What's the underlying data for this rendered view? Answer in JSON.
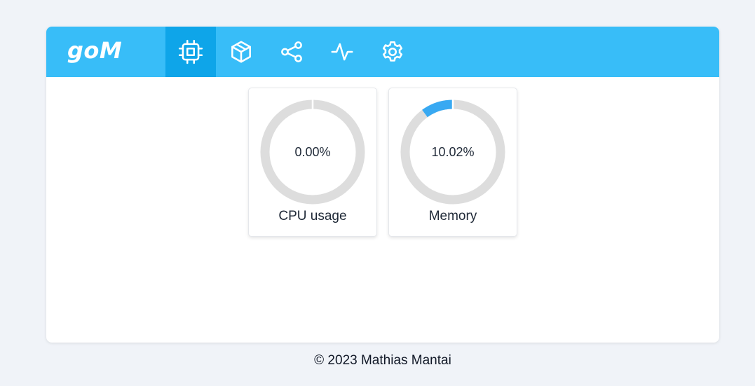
{
  "app": {
    "brand": "goM"
  },
  "nav": {
    "tabs": [
      {
        "name": "tab-system",
        "icon": "cpu-icon",
        "active": true
      },
      {
        "name": "tab-packages",
        "icon": "package-icon",
        "active": false
      },
      {
        "name": "tab-network",
        "icon": "share-icon",
        "active": false
      },
      {
        "name": "tab-activity",
        "icon": "activity-icon",
        "active": false
      },
      {
        "name": "tab-settings",
        "icon": "gear-icon",
        "active": false
      }
    ]
  },
  "stats": {
    "cpu": {
      "label": "CPU usage",
      "value_text": "0.00%",
      "percent": 0.0
    },
    "memory": {
      "label": "Memory",
      "value_text": "10.02%",
      "percent": 10.02
    }
  },
  "colors": {
    "navbar": "#38bdf8",
    "nav_active": "#0ea5e9",
    "gauge_track": "#dddddd",
    "gauge_fill": "#38a9f2",
    "page_bg": "#f0f3f8"
  },
  "footer": {
    "text": "© 2023 Mathias Mantai"
  }
}
